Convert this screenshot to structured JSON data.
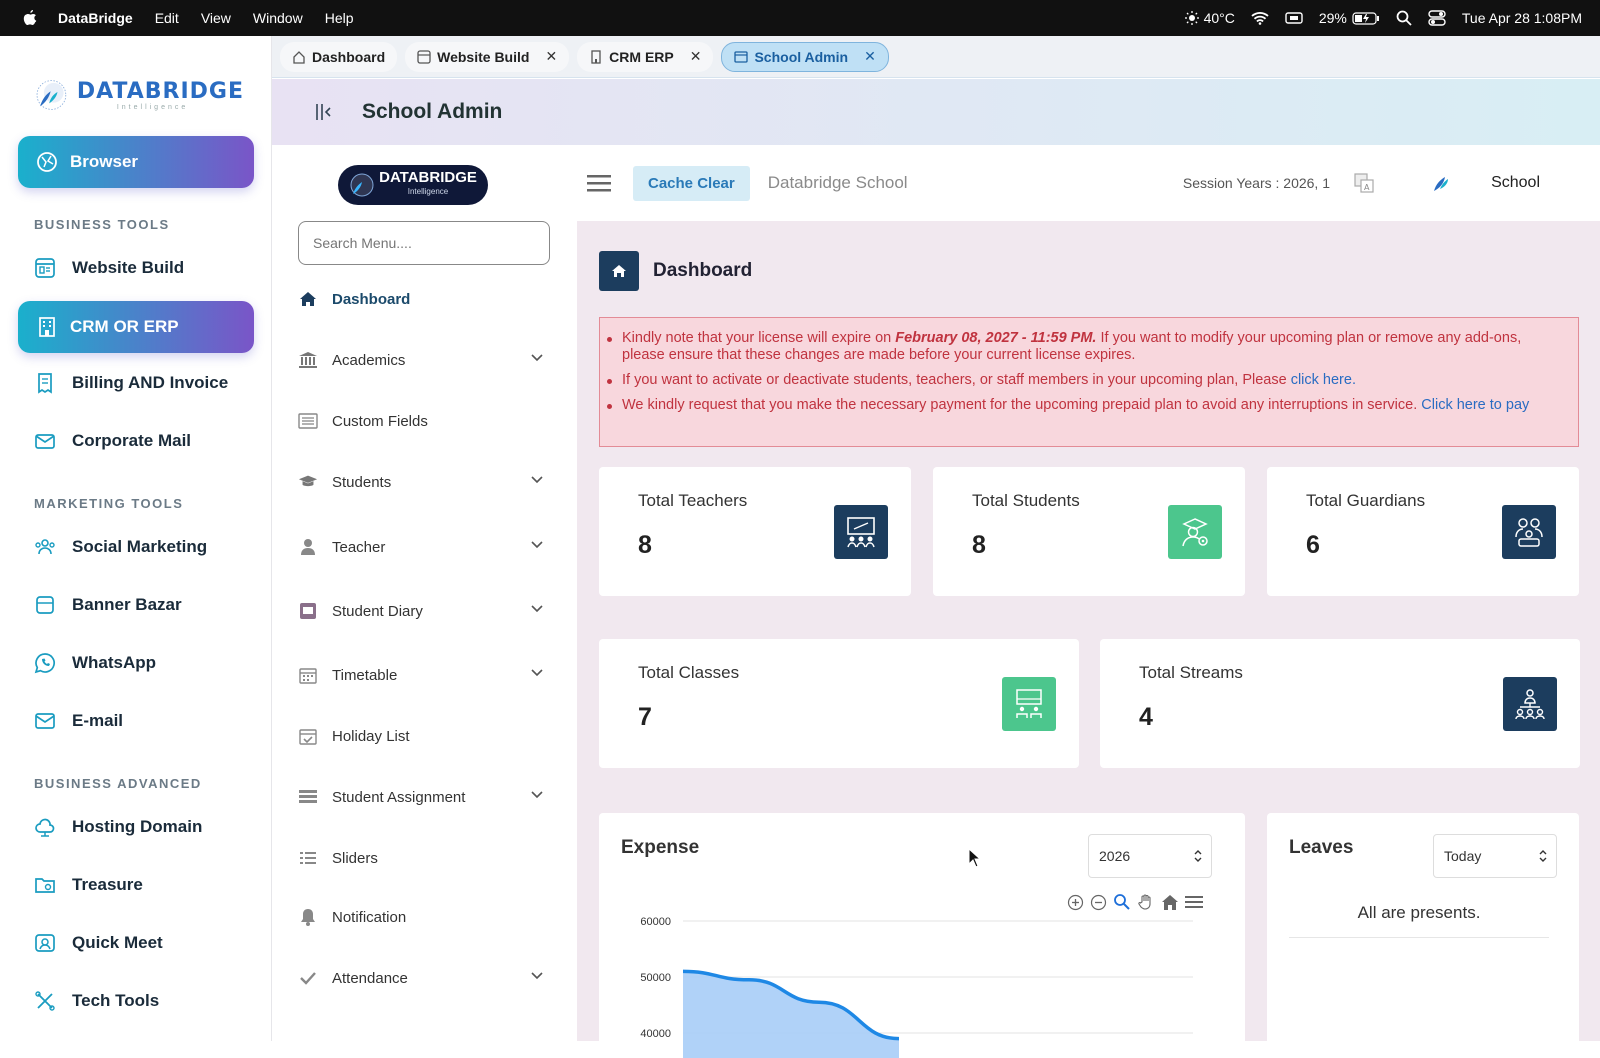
{
  "menubar": {
    "app": "DataBridge",
    "items": [
      "Edit",
      "View",
      "Window",
      "Help"
    ],
    "weather": "40°C",
    "battery": "29%",
    "datetime": "Tue Apr 28  1:08PM"
  },
  "appside": {
    "logo": {
      "name": "DATABRIDGE",
      "tagline": "Intelligence"
    },
    "browser_btn": "Browser",
    "sec_business": "BUSINESS TOOLS",
    "website_build": "Website Build",
    "crm": "CRM OR ERP",
    "billing": "Billing AND  Invoice",
    "corporate_mail": "Corporate Mail",
    "sec_marketing": "MARKETING TOOLS",
    "social": "Social Marketing",
    "banner": "Banner Bazar",
    "whatsapp": "WhatsApp",
    "email": "E-mail",
    "sec_advanced": "BUSINESS ADVANCED",
    "hosting": "Hosting Domain",
    "treasure": "Treasure",
    "quickmeet": "Quick Meet",
    "techtools": "Tech Tools"
  },
  "tabs": {
    "t1": "Dashboard",
    "t2": "Website Build",
    "t3": "CRM ERP",
    "t4": "School Admin"
  },
  "header": {
    "title": "School Admin"
  },
  "leftmenu": {
    "logo": "DATABRIDGE",
    "logo_sub": "Intelligence",
    "search_placeholder": "Search Menu....",
    "items": {
      "dashboard": "Dashboard",
      "academics": "Academics",
      "custom_fields": "Custom Fields",
      "students": "Students",
      "teacher": "Teacher",
      "diary": "Student Diary",
      "timetable": "Timetable",
      "holiday": "Holiday List",
      "assignment": "Student Assignment",
      "sliders": "Sliders",
      "notification": "Notification",
      "attendance": "Attendance"
    }
  },
  "topbar": {
    "cache_clear": "Cache Clear",
    "school_name": "Databridge School",
    "session": "Session Years : 2026, 1",
    "user": "School"
  },
  "dashboard": {
    "title": "Dashboard",
    "alert": {
      "l1a": "Kindly note that your license will expire on ",
      "l1b": "February 08, 2027 - 11:59 PM.",
      "l1c": " If you want to modify your upcoming plan or remove any add-ons, please ensure that these changes are made before your current license expires.",
      "l2a": "If you want to activate or deactivate students, teachers, or staff members in your upcoming plan, Please ",
      "l2link": "click here.",
      "l3a": "We kindly request that you make the necessary payment for the upcoming prepaid plan to avoid any interruptions in service. ",
      "l3link": "Click here to pay"
    },
    "cards": {
      "teachers_label": "Total Teachers",
      "teachers_val": "8",
      "students_label": "Total Students",
      "students_val": "8",
      "guardians_label": "Total Guardians",
      "guardians_val": "6",
      "classes_label": "Total Classes",
      "classes_val": "7",
      "streams_label": "Total Streams",
      "streams_val": "4"
    },
    "expense": {
      "title": "Expense",
      "year": "2026"
    },
    "leaves": {
      "title": "Leaves",
      "filter": "Today",
      "msg": "All are presents."
    }
  },
  "chart_data": {
    "type": "area",
    "title": "Expense",
    "x": [
      0,
      1,
      2,
      3
    ],
    "y_ticks": [
      40000,
      50000,
      60000
    ],
    "series": [
      {
        "values": [
          51000,
          49500,
          45500,
          39000
        ]
      }
    ],
    "color": "#1e88e5"
  }
}
